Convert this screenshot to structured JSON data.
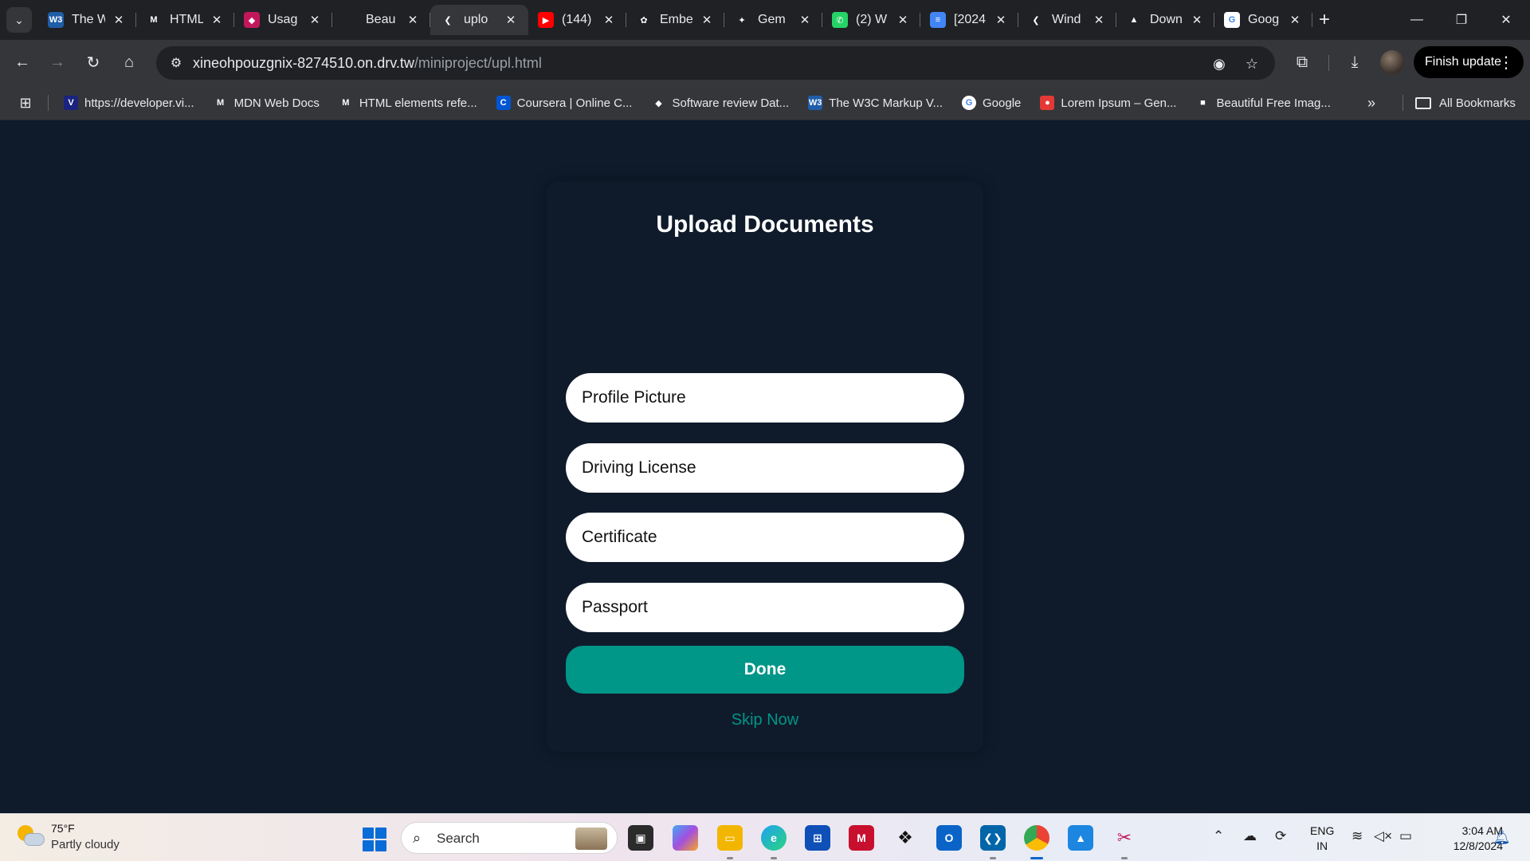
{
  "browser": {
    "tabs": [
      {
        "title": "The W",
        "icon": "w3c-icon",
        "color": "#1f5ea8",
        "glyph": "W3"
      },
      {
        "title": "HTML",
        "icon": "mdn-icon",
        "color": "#202124",
        "glyph": "M"
      },
      {
        "title": "Usag",
        "icon": "cube-icon",
        "color": "#c2185b",
        "glyph": "◆"
      },
      {
        "title": "Beau",
        "icon": "unsplash-icon",
        "color": "#202124",
        "glyph": ""
      },
      {
        "title": "uplo",
        "icon": "flutter-icon",
        "color": "#35363a",
        "glyph": "❮",
        "active": true
      },
      {
        "title": "(144)",
        "icon": "youtube-icon",
        "color": "#ff0000",
        "glyph": "▶"
      },
      {
        "title": "Embe",
        "icon": "openai-icon",
        "color": "#202124",
        "glyph": "✿"
      },
      {
        "title": "Gem",
        "icon": "gemini-icon",
        "color": "#202124",
        "glyph": "✦"
      },
      {
        "title": "(2) W",
        "icon": "whatsapp-icon",
        "color": "#25d366",
        "glyph": "✆"
      },
      {
        "title": "[2024",
        "icon": "docs-icon",
        "color": "#4285f4",
        "glyph": "≡"
      },
      {
        "title": "Wind",
        "icon": "flutter-icon",
        "color": "#202124",
        "glyph": "❮"
      },
      {
        "title": "Down",
        "icon": "android-icon",
        "color": "#202124",
        "glyph": "▲"
      },
      {
        "title": "Goog",
        "icon": "google-icon",
        "color": "#ffffff",
        "glyph": "G"
      }
    ],
    "url_host": "xineohpouzgnix-8274510.on.drv.tw",
    "url_path": "/miniproject/upl.html",
    "finish_update": "Finish update",
    "bookmarks": [
      {
        "label": "https://developer.vi...",
        "icon": "v-icon",
        "color": "#1a237e",
        "glyph": "V"
      },
      {
        "label": "MDN Web Docs",
        "icon": "mdn-icon",
        "color": "#35363a",
        "glyph": "M"
      },
      {
        "label": "HTML elements refe...",
        "icon": "mdn-icon",
        "color": "#35363a",
        "glyph": "M"
      },
      {
        "label": "Coursera | Online C...",
        "icon": "coursera-icon",
        "color": "#0056d2",
        "glyph": "C"
      },
      {
        "label": "Software review Dat...",
        "icon": "capterra-icon",
        "color": "#35363a",
        "glyph": "◆"
      },
      {
        "label": "The W3C Markup V...",
        "icon": "w3c-icon",
        "color": "#1f5ea8",
        "glyph": "W3"
      },
      {
        "label": "Google",
        "icon": "google-icon",
        "color": "#ffffff",
        "glyph": "G"
      },
      {
        "label": "Lorem Ipsum – Gen...",
        "icon": "lorem-icon",
        "color": "#e53935",
        "glyph": "●"
      },
      {
        "label": "Beautiful Free Imag...",
        "icon": "unsplash-icon",
        "color": "#35363a",
        "glyph": "■"
      }
    ],
    "all_bookmarks": "All Bookmarks"
  },
  "page": {
    "title": "Upload Documents",
    "fields": [
      "Profile Picture",
      "Driving License",
      "Certificate",
      "Passport"
    ],
    "done_label": "Done",
    "skip_label": "Skip Now",
    "accent": "#009688"
  },
  "taskbar": {
    "temperature": "75°F",
    "condition": "Partly cloudy",
    "search_placeholder": "Search",
    "lang_top": "ENG",
    "lang_bottom": "IN",
    "time": "3:04 AM",
    "date": "12/8/2024"
  }
}
